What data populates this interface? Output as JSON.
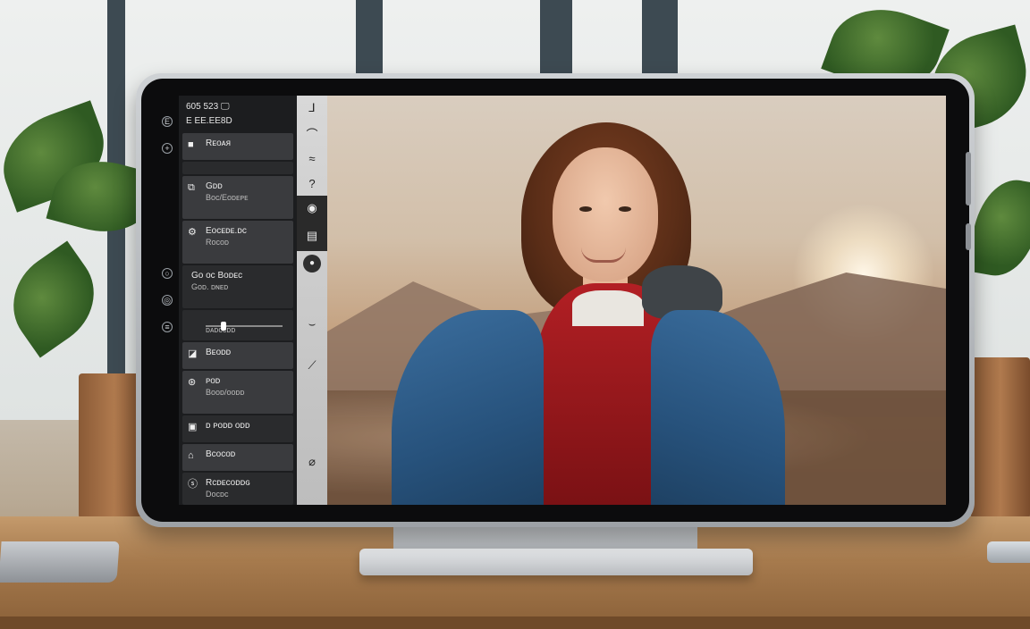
{
  "device": {
    "bezel_icons": [
      "camera-dot",
      "speaker-icon",
      "home-icon",
      "power-icon"
    ],
    "left_bezel_labels": [
      "E",
      "+",
      "=",
      "○",
      "◎",
      "≡"
    ]
  },
  "sidebar": {
    "header": {
      "row1": "605 523 🖵",
      "row2": "E EE.EE8D"
    },
    "items": [
      {
        "icon": "■",
        "label": "Rᴇᴏᴀᴙ",
        "sub": ""
      },
      {
        "icon": "",
        "label": "",
        "sub": ""
      },
      {
        "icon": "⧉",
        "label": "Gᴅᴅ",
        "sub": "Boc/Eoᴅᴇᴘᴇ"
      },
      {
        "icon": "⚙",
        "label": "Eoᴄᴇᴅᴇ.ᴅᴄ",
        "sub": "Roᴄᴏᴅ"
      },
      {
        "icon": "",
        "label": "Go ᴏᴄ Boᴅᴇᴄ",
        "sub": "Goᴅ. ᴅɴᴇᴅ"
      },
      {
        "icon": "",
        "label": "ᴅᴀᴅᴄᴄᴅᴅ",
        "sub": ""
      },
      {
        "icon": "◪",
        "label": "Bᴇᴏᴅᴅ",
        "sub": ""
      },
      {
        "icon": "⊛",
        "label": "ᴘᴏᴅ",
        "sub": "Bᴏᴏᴅ/ᴏᴏᴅᴅ"
      },
      {
        "icon": "▣",
        "label": "ᴅ ᴘᴏᴅᴅ ᴏᴅᴅ",
        "sub": ""
      },
      {
        "icon": "⌂",
        "label": "Bᴄᴏᴄᴏᴅ",
        "sub": ""
      },
      {
        "icon": "ⓢ",
        "label": "Rᴄᴅᴇᴄᴏᴅᴅɢ",
        "sub": "Dᴏᴄᴅᴄ"
      }
    ],
    "slider_value": 0.2
  },
  "toolstrip": {
    "tools": [
      "⅃",
      "⌒",
      "≈",
      "?",
      "◉",
      "▤",
      "●",
      "⌣",
      "⟋",
      "⌀"
    ]
  },
  "canvas": {
    "subject": "portrait photo"
  }
}
